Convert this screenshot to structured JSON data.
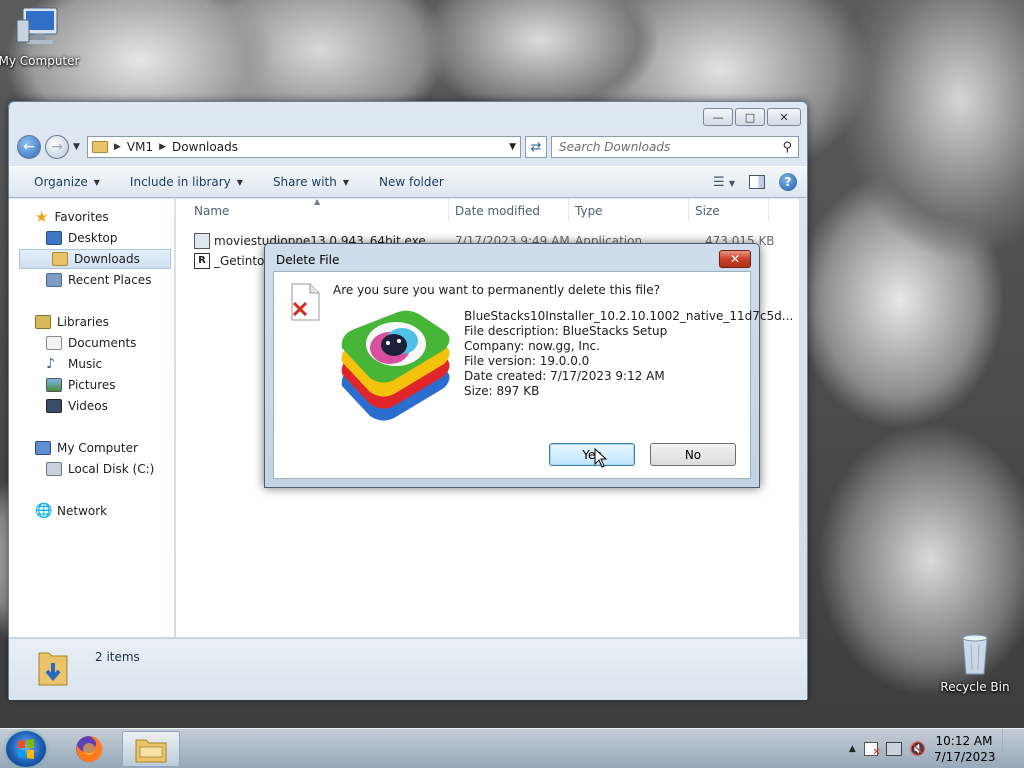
{
  "desktop": {
    "icons": [
      {
        "label": "My Computer"
      },
      {
        "label": "Recycle Bin"
      }
    ]
  },
  "explorer": {
    "breadcrumb": [
      "VM1",
      "Downloads"
    ],
    "search_placeholder": "Search Downloads",
    "toolbar": {
      "organize": "Organize",
      "include_in_library": "Include in library",
      "share_with": "Share with",
      "new_folder": "New folder"
    },
    "nav": {
      "favorites": "Favorites",
      "desktop": "Desktop",
      "downloads": "Downloads",
      "recent_places": "Recent Places",
      "libraries": "Libraries",
      "documents": "Documents",
      "music": "Music",
      "pictures": "Pictures",
      "videos": "Videos",
      "my_computer": "My Computer",
      "local_disk": "Local Disk (C:)",
      "network": "Network"
    },
    "columns": {
      "name": "Name",
      "date_modified": "Date modified",
      "type": "Type",
      "size": "Size"
    },
    "files": [
      {
        "name": "moviestudiopne13.0.943_64bit.exe",
        "date": "7/17/2023 9:49 AM",
        "type": "Application",
        "size": "473,015 KB"
      },
      {
        "name": "_Getintop",
        "date": "",
        "type": "",
        "size": ""
      }
    ],
    "status": "2 items"
  },
  "dialog": {
    "title": "Delete File",
    "question": "Are you sure you want to permanently delete this file?",
    "details": [
      "BlueStacks10Installer_10.2.10.1002_native_11d7c5d...",
      "File description: BlueStacks Setup",
      "Company: now.gg, Inc.",
      "File version: 19.0.0.0",
      "Date created: 7/17/2023 9:12 AM",
      "Size: 897 KB"
    ],
    "yes_label": "Yes",
    "no_label": "No"
  },
  "taskbar": {
    "time": "10:12 AM",
    "date": "7/17/2023"
  }
}
